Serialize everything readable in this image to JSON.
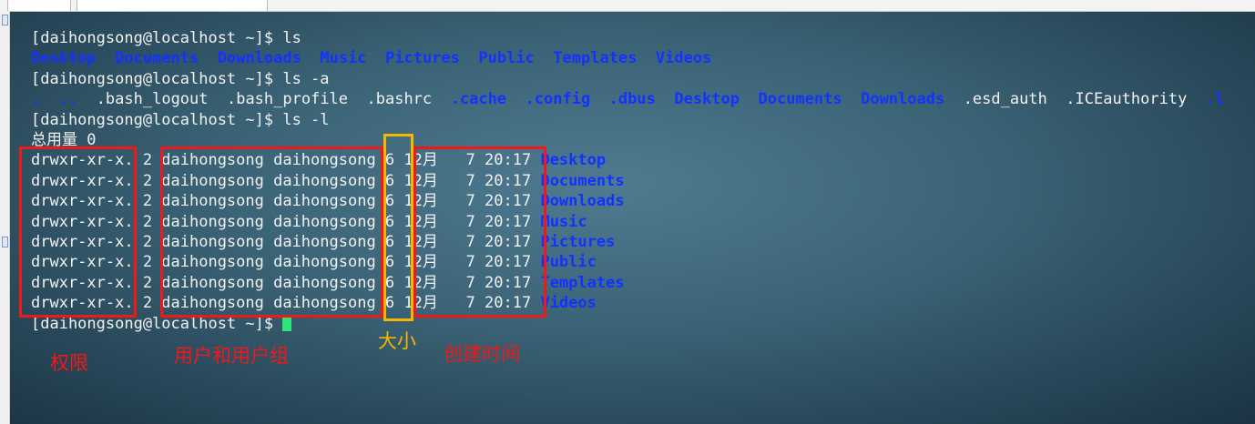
{
  "terminal": {
    "lines": [
      [
        {
          "text": "[daihongsong@localhost ~]$ ls",
          "kind": "plain"
        }
      ],
      [
        {
          "text": "Desktop",
          "kind": "dir"
        },
        {
          "text": "  ",
          "kind": "plain"
        },
        {
          "text": "Documents",
          "kind": "dir"
        },
        {
          "text": "  ",
          "kind": "plain"
        },
        {
          "text": "Downloads",
          "kind": "dir"
        },
        {
          "text": "  ",
          "kind": "plain"
        },
        {
          "text": "Music",
          "kind": "dir"
        },
        {
          "text": "  ",
          "kind": "plain"
        },
        {
          "text": "Pictures",
          "kind": "dir"
        },
        {
          "text": "  ",
          "kind": "plain"
        },
        {
          "text": "Public",
          "kind": "dir"
        },
        {
          "text": "  ",
          "kind": "plain"
        },
        {
          "text": "Templates",
          "kind": "dir"
        },
        {
          "text": "  ",
          "kind": "plain"
        },
        {
          "text": "Videos",
          "kind": "dir"
        }
      ],
      [
        {
          "text": "[daihongsong@localhost ~]$ ls -a",
          "kind": "plain"
        }
      ],
      [
        {
          "text": ".",
          "kind": "dir"
        },
        {
          "text": "  ",
          "kind": "plain"
        },
        {
          "text": "..",
          "kind": "dir"
        },
        {
          "text": "  .bash_logout  .bash_profile  .bashrc  ",
          "kind": "plain"
        },
        {
          "text": ".cache",
          "kind": "dir"
        },
        {
          "text": "  ",
          "kind": "plain"
        },
        {
          "text": ".config",
          "kind": "dir"
        },
        {
          "text": "  ",
          "kind": "plain"
        },
        {
          "text": ".dbus",
          "kind": "dir"
        },
        {
          "text": "  ",
          "kind": "plain"
        },
        {
          "text": "Desktop",
          "kind": "dir"
        },
        {
          "text": "  ",
          "kind": "plain"
        },
        {
          "text": "Documents",
          "kind": "dir"
        },
        {
          "text": "  ",
          "kind": "plain"
        },
        {
          "text": "Downloads",
          "kind": "dir"
        },
        {
          "text": "  .esd_auth  .ICEauthority  ",
          "kind": "plain"
        },
        {
          "text": ".l",
          "kind": "dir"
        }
      ],
      [
        {
          "text": "[daihongsong@localhost ~]$ ls -l",
          "kind": "plain"
        }
      ],
      [
        {
          "text": "总用量 0",
          "kind": "plain"
        }
      ],
      [
        {
          "text": "drwxr-xr-x. 2 daihongsong daihongsong 6 12月   7 20:17 ",
          "kind": "plain"
        },
        {
          "text": "Desktop",
          "kind": "dir"
        }
      ],
      [
        {
          "text": "drwxr-xr-x. 2 daihongsong daihongsong 6 12月   7 20:17 ",
          "kind": "plain"
        },
        {
          "text": "Documents",
          "kind": "dir"
        }
      ],
      [
        {
          "text": "drwxr-xr-x. 2 daihongsong daihongsong 6 12月   7 20:17 ",
          "kind": "plain"
        },
        {
          "text": "Downloads",
          "kind": "dir"
        }
      ],
      [
        {
          "text": "drwxr-xr-x. 2 daihongsong daihongsong 6 12月   7 20:17 ",
          "kind": "plain"
        },
        {
          "text": "Music",
          "kind": "dir"
        }
      ],
      [
        {
          "text": "drwxr-xr-x. 2 daihongsong daihongsong 6 12月   7 20:17 ",
          "kind": "plain"
        },
        {
          "text": "Pictures",
          "kind": "dir"
        }
      ],
      [
        {
          "text": "drwxr-xr-x. 2 daihongsong daihongsong 6 12月   7 20:17 ",
          "kind": "plain"
        },
        {
          "text": "Public",
          "kind": "dir"
        }
      ],
      [
        {
          "text": "drwxr-xr-x. 2 daihongsong daihongsong 6 12月   7 20:17 ",
          "kind": "plain"
        },
        {
          "text": "Templates",
          "kind": "dir"
        }
      ],
      [
        {
          "text": "drwxr-xr-x. 2 daihongsong daihongsong 6 12月   7 20:17 ",
          "kind": "plain"
        },
        {
          "text": "Videos",
          "kind": "dir"
        }
      ],
      [
        {
          "text": "[daihongsong@localhost ~]$ ",
          "kind": "plain"
        }
      ]
    ]
  },
  "annotations": {
    "permissions": "权限",
    "owner_group": "用户和用户组",
    "size": "大小",
    "created_time": "创建时间"
  },
  "colors": {
    "directory": "#1233ff",
    "plain_text": "#f2f2f2",
    "cursor": "#2ee57a",
    "annotation_red": "#f01818",
    "annotation_yellow": "#f5b800"
  }
}
